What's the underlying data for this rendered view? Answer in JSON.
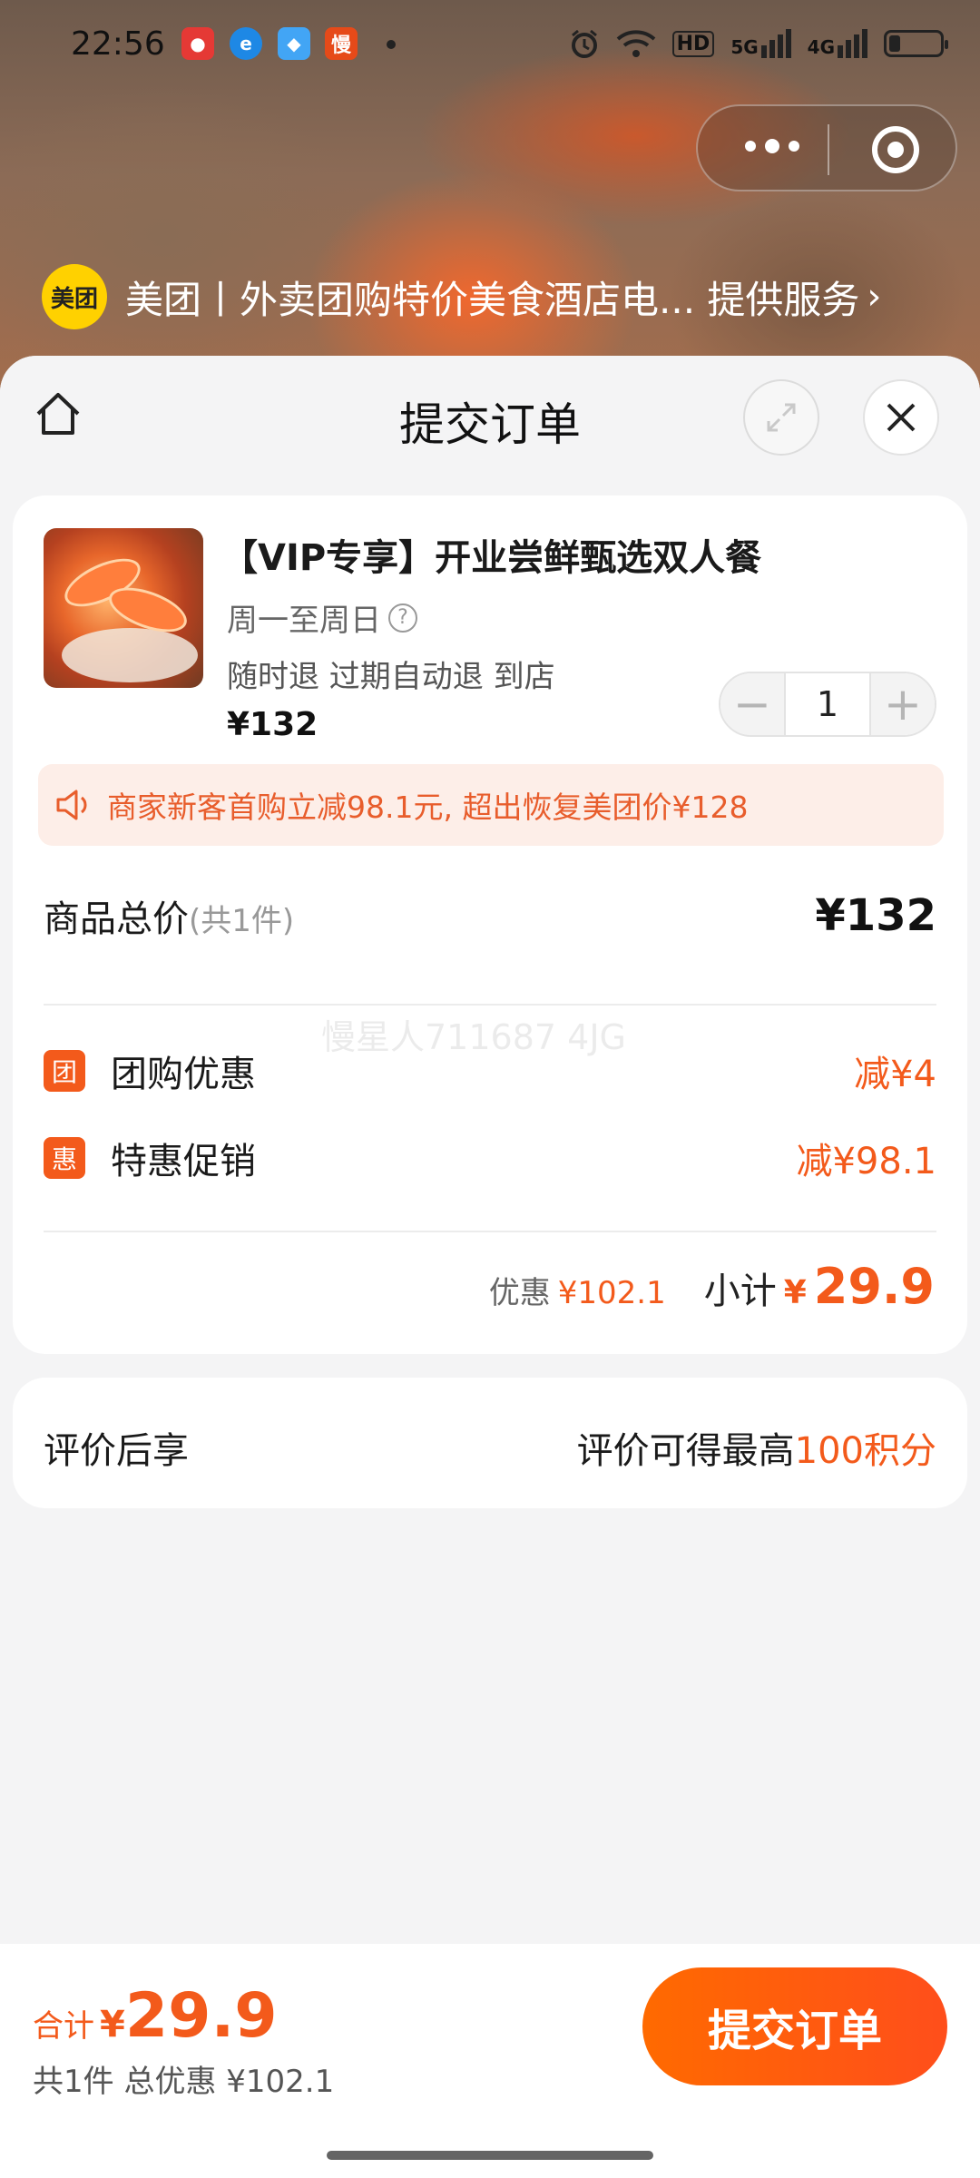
{
  "status_bar": {
    "time": "22:56",
    "app_icons": [
      "red-app-icon",
      "browser-app-icon",
      "blue-app-icon",
      "慢"
    ],
    "indicators": [
      "alarm-icon",
      "wifi-icon",
      "HD",
      "5G",
      "4G",
      "battery-icon"
    ]
  },
  "mini_program": {
    "provider_logo": "美团",
    "provider_text": "美团丨外卖团购特价美食酒店电... 提供服务"
  },
  "sheet": {
    "title": "提交订单"
  },
  "product": {
    "title": "【VIP专享】开业尝鲜甄选双人餐",
    "days": "周一至周日",
    "tags": "随时退 过期自动退 到店",
    "price": "¥132",
    "quantity": "1",
    "minus": "−",
    "plus": "+"
  },
  "promo": {
    "text": "商家新客首购立减98.1元, 超出恢复美团价¥128"
  },
  "summary": {
    "total_label": "商品总价",
    "total_count": "(共1件)",
    "total_value": "¥132",
    "discounts": [
      {
        "badge": "团",
        "label": "团购优惠",
        "value": "减¥4"
      },
      {
        "badge": "惠",
        "label": "特惠促销",
        "value": "减¥98.1"
      }
    ],
    "watermark": "慢星人711687 4JG",
    "discount_label": "优惠",
    "discount_value": "¥102.1",
    "subtotal_label": "小计",
    "subtotal_currency": "¥",
    "subtotal_amount": "29.9"
  },
  "review": {
    "left": "评价后享",
    "right_prefix": "评价可得最高",
    "right_highlight": "100积分"
  },
  "bottom_bar": {
    "total_label": "合计",
    "currency": "¥",
    "amount": "29.9",
    "detail": "共1件 总优惠 ¥102.1",
    "submit_label": "提交订单"
  },
  "colors": {
    "accent": "#f35a1b",
    "promo_bg": "#fdeee8",
    "meituan_yellow": "#ffd100"
  }
}
